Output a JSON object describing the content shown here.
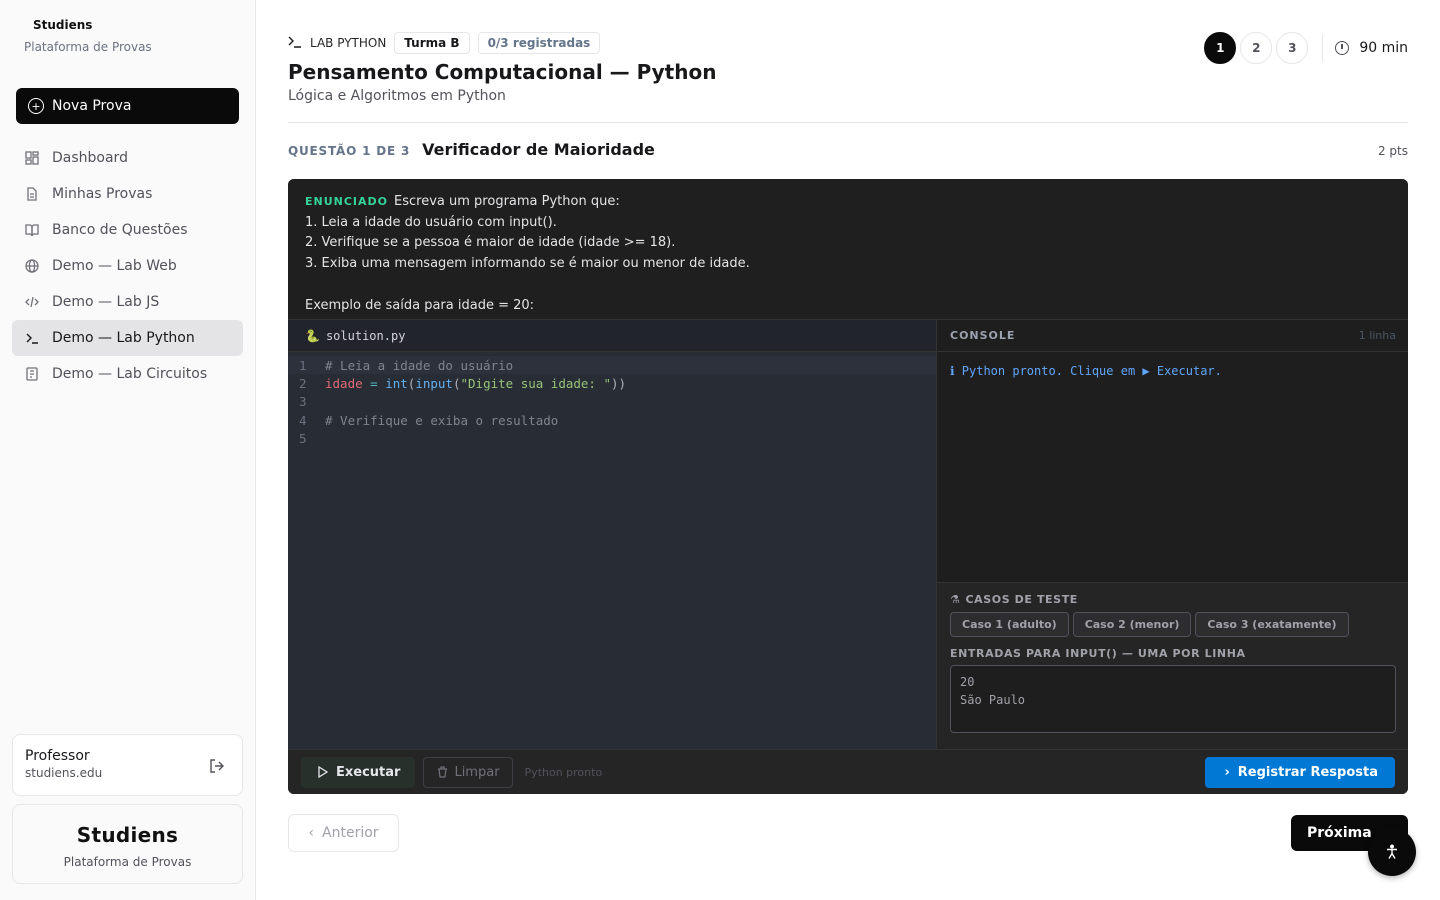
{
  "sidebar": {
    "brand_name": "Studiens",
    "brand_sub": "Plataforma de Provas",
    "new_exam_label": "Nova Prova",
    "items": [
      {
        "label": "Dashboard",
        "icon": "dashboard-icon"
      },
      {
        "label": "Minhas Provas",
        "icon": "file-icon"
      },
      {
        "label": "Banco de Questões",
        "icon": "book-icon"
      },
      {
        "label": "Demo — Lab Web",
        "icon": "globe-icon"
      },
      {
        "label": "Demo — Lab JS",
        "icon": "code-icon"
      },
      {
        "label": "Demo — Lab Python",
        "icon": "terminal-icon",
        "active": true
      },
      {
        "label": "Demo — Lab Circuitos",
        "icon": "circuit-icon"
      }
    ],
    "user": {
      "name": "Professor",
      "email": "studiens.edu"
    },
    "footer": {
      "title": "Studiens",
      "subtitle": "Plataforma de Provas"
    }
  },
  "header": {
    "lab_label": "LAB PYTHON",
    "class_badge": "Turma B",
    "registered_badge": "0/3 registradas",
    "title": "Pensamento Computacional — Python",
    "subtitle": "Lógica e Algoritmos em Python",
    "steps": [
      "1",
      "2",
      "3"
    ],
    "active_step": "1",
    "timer": "90 min"
  },
  "question": {
    "number_label": "QUESTÃO 1 DE 3",
    "title": "Verificador de Maioridade",
    "points": "2 pts",
    "statement_tag": "ENUNCIADO",
    "statement_lines": [
      "Escreva um programa Python que:",
      "1. Leia a idade do usuário com input().",
      "2. Verifique se a pessoa é maior de idade (idade >= 18).",
      "3. Exiba uma mensagem informando se é maior ou menor de idade.",
      "",
      "Exemplo de saída para idade = 20:"
    ]
  },
  "editor": {
    "filename": "solution.py",
    "line_numbers": [
      "1",
      "2",
      "3",
      "4",
      "5"
    ],
    "code": {
      "l1_comment": "# Leia a idade do usuário",
      "l2_var": "idade",
      "l2_eq": " = ",
      "l2_fn1": "int",
      "l2_p1": "(",
      "l2_fn2": "input",
      "l2_p2": "(",
      "l2_str": "\"Digite sua idade: \"",
      "l2_p3": "))",
      "l4_comment": "# Verifique e exiba o resultado"
    }
  },
  "console": {
    "title": "CONSOLE",
    "line_count": "1 linha",
    "message": "ℹ Python pronto. Clique em ▶ Executar."
  },
  "tests": {
    "title": "CASOS DE TESTE",
    "cases": [
      "Caso 1 (adulto)",
      "Caso 2 (menor)",
      "Caso 3 (exatamente)"
    ],
    "inputs_label": "ENTRADAS PARA INPUT() — UMA POR LINHA",
    "inputs_value": "20\nSão Paulo"
  },
  "toolbar": {
    "run_label": "Executar",
    "clear_label": "Limpar",
    "status": "Python pronto",
    "submit_label": "Registrar Resposta"
  },
  "nav": {
    "prev_label": "Anterior",
    "next_label": "Próxima"
  },
  "colors": {
    "accent": "#0078d4",
    "primary": "#0a0a0a",
    "statement_tag": "#34d399"
  }
}
